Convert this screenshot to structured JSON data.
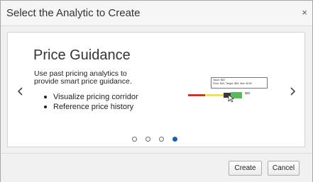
{
  "dialog": {
    "title": "Select the Analytic to Create",
    "close_label": "×"
  },
  "slide": {
    "title": "Price Guidance",
    "description": "Use past pricing analytics to provide smart price guidance.",
    "bullets": [
      "Visualize pricing corridor",
      "Reference price history"
    ],
    "preview": {
      "tooltip_line1": "Value: $82",
      "tooltip_line2": "Floor: $40, Target: $65, Max: $100",
      "price_label": "$82",
      "colors": {
        "red": "#c0392b",
        "yellow": "#f1e05a",
        "dark": "#3a3a3a",
        "green": "#5cb85c"
      }
    }
  },
  "carousel": {
    "page_count": 4,
    "active_index": 3,
    "accent": "#1f5fa6"
  },
  "footer": {
    "create_label": "Create",
    "cancel_label": "Cancel"
  }
}
